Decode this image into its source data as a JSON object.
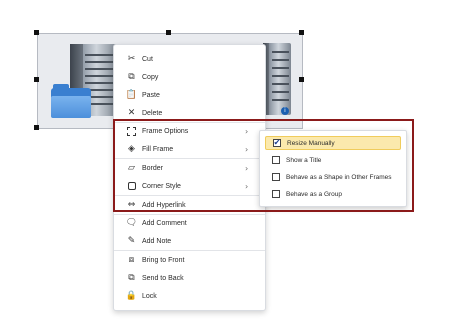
{
  "context_menu": {
    "items": [
      {
        "label": "Cut",
        "icon": "scissors-icon"
      },
      {
        "label": "Copy",
        "icon": "copy-icon"
      },
      {
        "label": "Paste",
        "icon": "paste-icon"
      },
      {
        "label": "Delete",
        "icon": "delete-icon"
      },
      {
        "label": "Frame Options",
        "icon": "frame-options-icon",
        "submenu": true
      },
      {
        "label": "Fill Frame",
        "icon": "fill-bucket-icon",
        "submenu": true
      },
      {
        "label": "Border",
        "icon": "border-icon",
        "submenu": true
      },
      {
        "label": "Corner Style",
        "icon": "corner-style-icon",
        "submenu": true
      },
      {
        "label": "Add Hyperlink",
        "icon": "link-icon"
      },
      {
        "label": "Add Comment",
        "icon": "comment-icon"
      },
      {
        "label": "Add Note",
        "icon": "note-icon"
      },
      {
        "label": "Bring to Front",
        "icon": "bring-to-front-icon"
      },
      {
        "label": "Send to Back",
        "icon": "send-to-back-icon"
      },
      {
        "label": "Lock",
        "icon": "lock-icon"
      }
    ],
    "chevron": "›"
  },
  "frame_options_submenu": {
    "items": [
      {
        "label": "Resize Manually",
        "checked": true
      },
      {
        "label": "Show a Title",
        "checked": false
      },
      {
        "label": "Behave as a Shape in Other Frames",
        "checked": false
      },
      {
        "label": "Behave as a Group",
        "checked": false
      }
    ]
  },
  "colors": {
    "highlight_border": "#8b1a1a",
    "active_item_bg": "#fbe9ad",
    "active_item_border": "#f0cc5c"
  }
}
